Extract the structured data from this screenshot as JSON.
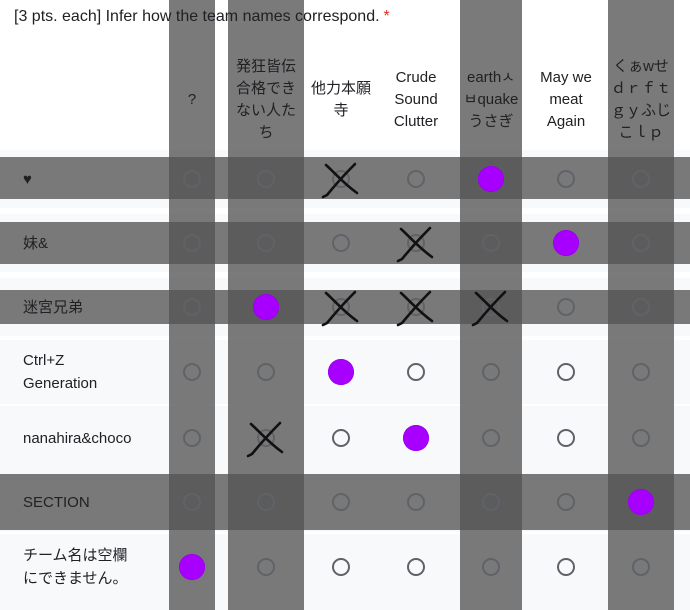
{
  "question": {
    "text": "[3 pts. each] Infer how the team names correspond.",
    "required_mark": "*"
  },
  "columns": [
    "?",
    "発狂皆伝\n合格でき\nない人た\nち",
    "他力本願\n寺",
    "Crude\nSound\nClutter",
    "earthㅅ\nㅂquake\nうさぎ",
    "May we\nmeat\nAgain",
    "くぁwせ\nｄｒｆｔ\nｇｙふじ\nこｌｐ"
  ],
  "rows": [
    "♥",
    "妹&",
    "迷宮兄弟",
    "Ctrl+Z\nGeneration",
    "nanahira&choco",
    "SECTION",
    "チーム名は空欄\nにできません。"
  ],
  "grid": {
    "filled": [
      [
        0,
        4
      ],
      [
        1,
        5
      ],
      [
        2,
        1
      ],
      [
        3,
        2
      ],
      [
        4,
        3
      ],
      [
        5,
        6
      ],
      [
        6,
        0
      ]
    ],
    "crossed": [
      [
        0,
        2
      ],
      [
        1,
        3
      ],
      [
        2,
        2
      ],
      [
        2,
        3
      ],
      [
        2,
        4
      ],
      [
        4,
        1
      ]
    ],
    "shaded_columns": [
      0,
      1,
      4,
      6
    ],
    "shaded_rows": [
      0,
      1,
      2,
      5
    ],
    "selected_color": "#a800ff",
    "shade_color": "#555555"
  }
}
